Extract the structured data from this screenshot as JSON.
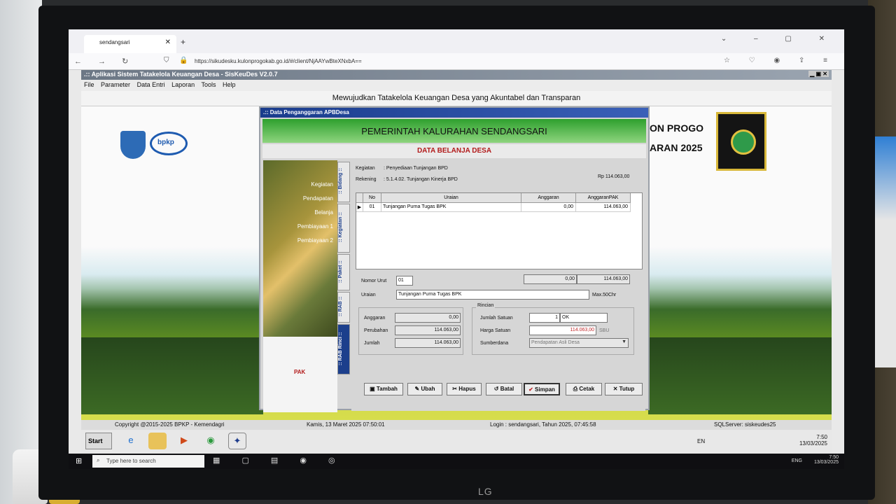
{
  "browser": {
    "tab_title": "sendangsari",
    "url": "https://sikudesku.kulonprogokab.go.id/#/client/NjAAYwBteXNxbA=="
  },
  "app": {
    "title": ".:: Aplikasi Sistem Tatakelola Keuangan Desa - SisKeuDes V2.0.7",
    "menu": [
      "File",
      "Parameter",
      "Data Entri",
      "Laporan",
      "Tools",
      "Help"
    ],
    "motto": "Mewujudkan Tatakelola Keuangan Desa yang Akuntabel dan Transparan",
    "right_text_1": "ON PROGO",
    "right_text_2": "ARAN 2025",
    "logo_text": "bpkp"
  },
  "dialog": {
    "title": ".:: Data Penganggaran APBDesa",
    "header": "PEMERINTAH KALURAHAN SENDANGSARI",
    "subheader": "DATA BELANJA DESA",
    "left_items": [
      "Kegiatan",
      "Pendapatan",
      "Belanja",
      "Pembiayaan 1",
      "Pembiayaan 2"
    ],
    "pak_label": "PAK",
    "vtabs": [
      ":: Bidang ::",
      ":: Kegiatan ::",
      ":: Paket ::",
      ":: RAB ::",
      ":: RAB Rinci ::"
    ],
    "kegiatan_label": "Kegiatan",
    "kegiatan_value": ": Penyediaan Tunjangan BPD",
    "rekening_label": "Rekening",
    "rekening_value": ": 5.1.4.02. Tunjangan Kinerja BPD",
    "rekening_total": "Rp 114.063,00",
    "table": {
      "headers": [
        "No",
        "Uraian",
        "Anggaran",
        "AnggaranPAK"
      ],
      "rows": [
        {
          "no": "01",
          "uraian": "Tunjangan Purna Tugas BPK",
          "anggaran": "0,00",
          "anggaran_pak": "114.063,00"
        }
      ]
    },
    "nomor_urut_label": "Nomor Urut",
    "nomor_urut_value": "01",
    "nomor_anggaran": "0,00",
    "nomor_anggaran_pak": "114.063,00",
    "uraian_label": "Uraian",
    "uraian_value": "Tunjangan Purna Tugas BPK",
    "max_chr": "Max.50Chr",
    "anggaran_label": "Anggaran",
    "anggaran_value": "0,00",
    "perubahan_label": "Perubahan",
    "perubahan_value": "114.063,00",
    "jumlah_label": "Jumlah",
    "jumlah_value": "114.063,00",
    "rincian_label": "Rincian",
    "jumlah_satuan_label": "Jumlah Satuan",
    "jumlah_satuan_value": "1",
    "satuan_value": "OK",
    "harga_satuan_label": "Harga Satuan",
    "harga_satuan_value": "114.063,00",
    "sbu_label": "SBU",
    "sumberdana_label": "Sumberdana",
    "sumberdana_value": "Pendapatan Asli Desa",
    "buttons": [
      "Tambah",
      "Ubah",
      "Hapus",
      "Batal",
      "Simpan",
      "Cetak",
      "Tutup"
    ]
  },
  "statusbar": {
    "copyright": "Copyright @2015-2025 BPKP - Kemendagri",
    "datetime": "Kamis, 13 Maret 2025  07:50:01",
    "login": "Login : sendangsari,  Tahun 2025,  07:45:58",
    "sqlserver": "SQLServer: siskeudes25"
  },
  "xp_taskbar": {
    "start": "Start",
    "lang": "EN",
    "time": "7:50",
    "date": "13/03/2025"
  },
  "win10_taskbar": {
    "search_placeholder": "Type here to search",
    "lang": "ENG",
    "time": "7:50",
    "date": "13/03/2025"
  },
  "monitor_brand": "LG"
}
